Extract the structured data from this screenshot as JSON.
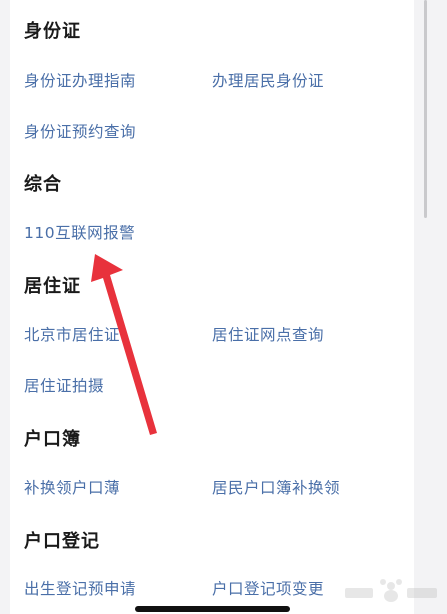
{
  "sections": [
    {
      "title": "身份证",
      "links": [
        "身份证办理指南",
        "办理居民身份证",
        "身份证预约查询"
      ]
    },
    {
      "title": "综合",
      "links": [
        "110互联网报警"
      ]
    },
    {
      "title": "居住证",
      "links": [
        "北京市居住证",
        "居住证网点查询",
        "居住证拍摄"
      ]
    },
    {
      "title": "户口簿",
      "links": [
        "补换领户口薄",
        "居民户口簿补换领"
      ]
    },
    {
      "title": "户口登记",
      "links": [
        "出生登记预申请",
        "户口登记项变更"
      ]
    }
  ],
  "annotation": {
    "arrow_color": "#e8323c",
    "arrow_target": "110互联网报警"
  },
  "colors": {
    "link": "#4a6fa8",
    "title": "#1a1a1a",
    "background": "#f3f3f5",
    "card": "#ffffff"
  }
}
